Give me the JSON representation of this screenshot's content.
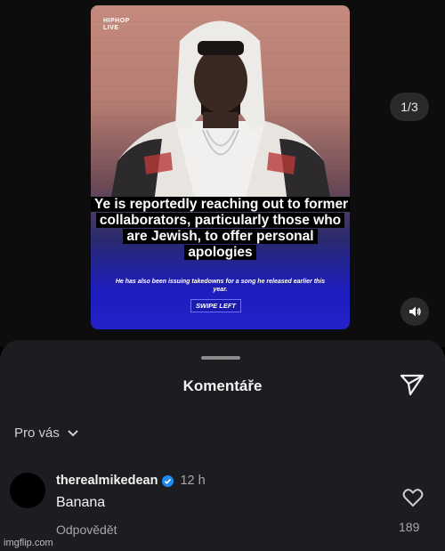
{
  "post": {
    "logo_text": "HIPHOP\nLIVE",
    "headline": "Ye is reportedly reaching out to former collaborators, particularly those who are Jewish, to offer personal apologies",
    "subline": "He has also been issuing takedowns for a song he released earlier this year.",
    "swipe_label": "SWIPE LEFT",
    "counter": "1/3",
    "sound_icon": "speaker-icon"
  },
  "comments_sheet": {
    "title": "Komentáře",
    "send_icon": "send-icon",
    "filter_label": "Pro vás",
    "filter_icon": "chevron-down-icon",
    "comments": [
      {
        "username": "therealmikedean",
        "verified": true,
        "time": "12 h",
        "text": "Banana",
        "reply_label": "Odpovědět",
        "like_count": "189"
      }
    ]
  },
  "watermark": "imgflip.com",
  "colors": {
    "verified": "#1d8cf0",
    "sheet_bg": "#1c1d20",
    "post_blue": "#2222c8"
  }
}
